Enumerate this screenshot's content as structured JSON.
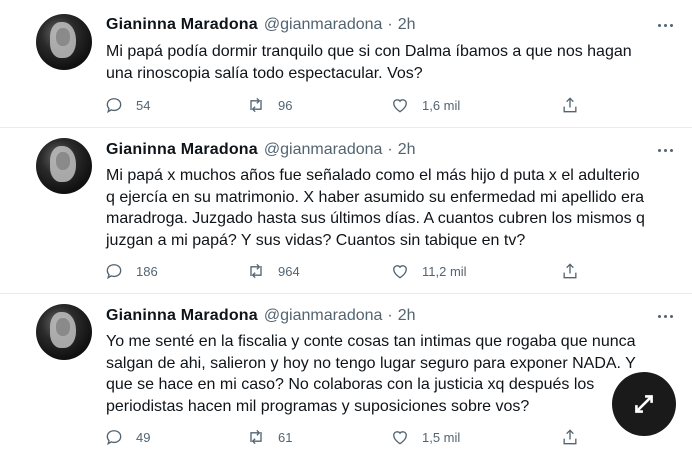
{
  "tweets": [
    {
      "author_name": "Gianinna Maradona",
      "handle": "@gianmaradona",
      "separator": "·",
      "time": "2h",
      "lines": [
        "Mi papá podía dormir tranquilo que si con Dalma íbamos a que nos hagan",
        "una rinoscopia salía todo espectacular. Vos?"
      ],
      "replies": "54",
      "retweets": "96",
      "likes": "1,6 mil"
    },
    {
      "author_name": "Gianinna Maradona",
      "handle": "@gianmaradona",
      "separator": "·",
      "time": "2h",
      "lines": [
        "Mi papá x muchos años fue señalado como el más hijo d puta x el adulterio",
        "q ejercía en su matrimonio. X haber asumido su enfermedad mi apellido era",
        "maradroga. Juzgado hasta sus últimos días. A cuantos cubren los mismos q",
        "juzgan a mi papá? Y sus vidas? Cuantos sin tabique en tv?"
      ],
      "replies": "186",
      "retweets": "964",
      "likes": "11,2 mil"
    },
    {
      "author_name": "Gianinna Maradona",
      "handle": "@gianmaradona",
      "separator": "·",
      "time": "2h",
      "lines": [
        "Yo me senté en la fiscalia y conte cosas tan intimas que rogaba que nunca",
        "salgan de ahi, salieron y hoy no tengo lugar seguro para exponer NADA. Y",
        "que se hace en mi caso? No colaboras con la justicia xq después los",
        "periodistas hacen mil programas y suposiciones sobre vos?"
      ],
      "replies": "49",
      "retweets": "61",
      "likes": "1,5 mil"
    }
  ],
  "icons": {
    "reply": "reply-icon",
    "retweet": "retweet-icon",
    "like": "heart-icon",
    "share": "share-icon",
    "more": "more-options-icon",
    "expand": "expand-icon"
  },
  "colors": {
    "text": "#0f1419",
    "secondary": "#536471",
    "divider": "#e6ecf0",
    "expand_button": "#1a1a1a"
  }
}
